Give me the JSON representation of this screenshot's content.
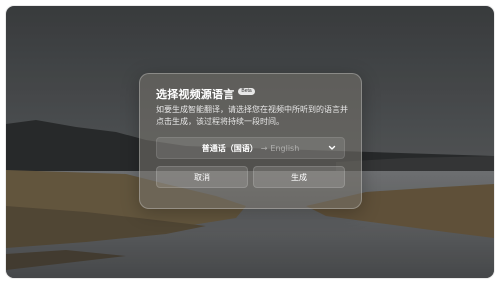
{
  "dialog": {
    "title": "选择视频源语言",
    "badge": "Beta",
    "description": "如要生成智能翻译，请选择您在视频中所听到的语言并点击生成，该过程将持续一段时间。",
    "language_select": {
      "source": "普通话（国语）",
      "arrow": "→",
      "target": "English"
    },
    "cancel_label": "取消",
    "generate_label": "生成"
  },
  "colors": {
    "overlay": "#76726c",
    "text": "#ffffff",
    "sky": "#4a4c4d",
    "water": "#6b6d70"
  },
  "icons": {
    "dropdown": "chevron-down-icon"
  }
}
